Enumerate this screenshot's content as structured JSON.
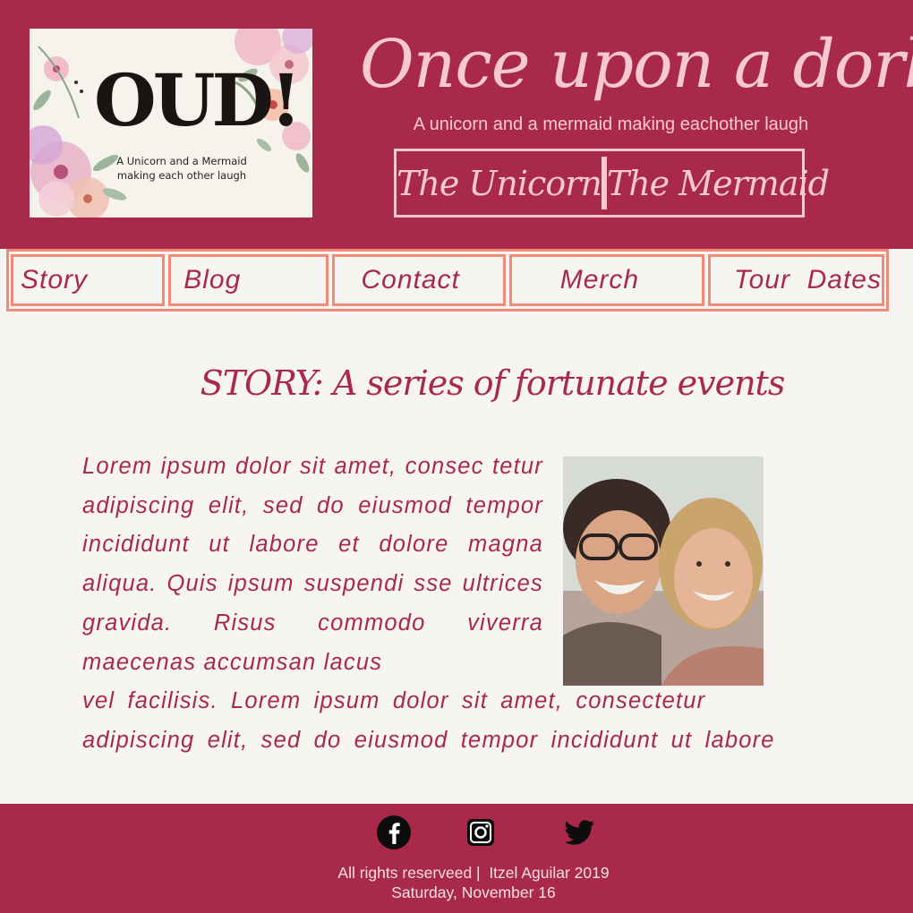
{
  "logo": {
    "word": "OUD!",
    "tagline_line1": "A Unicorn and a Mermaid",
    "tagline_line2": "making each other laugh"
  },
  "header": {
    "title": "Once upon a dork",
    "subtitle": "A unicorn and a mermaid making eachother laugh",
    "profiles": [
      "The Unicorn",
      "The Mermaid"
    ]
  },
  "nav": {
    "items": [
      "Story",
      "Blog",
      "Contact",
      "Merch",
      "Tour  Dates"
    ]
  },
  "main": {
    "title": "STORY: A series of fortunate events",
    "text_wrapped": "Lorem ipsum dolor sit amet, consec tetur adipiscing elit, sed do eiusmod tempor incididunt ut labore et dolore magna aliqua. Quis ipsum suspendi sse ultrices gravida. Risus commodo viverra maecenas accumsan lacus",
    "text_tail": "vel facilisis. Lorem ipsum dolor sit amet, consectetur adipiscing elit, sed do eiusmod tempor incididunt ut labore"
  },
  "footer": {
    "social": [
      "facebook-icon",
      "instagram-icon",
      "twitter-icon"
    ],
    "copyright": "All rights reserveed |  Itzel Aguilar 2019",
    "date": "Saturday, November 16"
  },
  "colors": {
    "brand": "#a8294a",
    "pink_light": "#f6c9d2",
    "nav_border": "#f38a78",
    "background": "#f7f5f1"
  }
}
